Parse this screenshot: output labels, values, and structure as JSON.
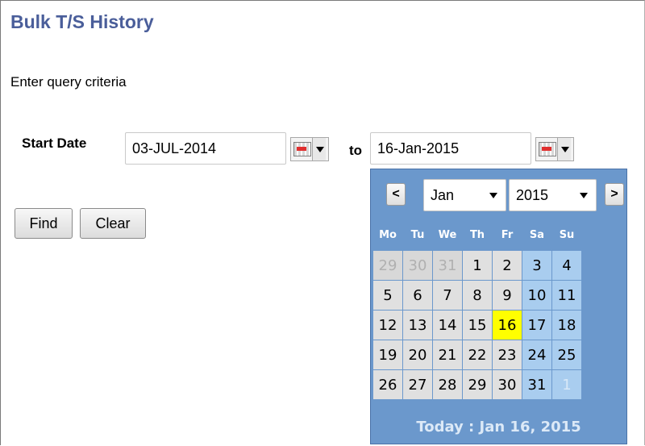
{
  "page": {
    "title": "Bulk T/S History",
    "subtitle": "Enter query criteria"
  },
  "form": {
    "start_label": "Start Date",
    "start_value": "03-JUL-2014",
    "to_label": "to",
    "end_value": "16-Jan-2015",
    "find_label": "Find",
    "clear_label": "Clear",
    "calendar_icon": "calendar-dropdown-icon"
  },
  "calendar": {
    "prev_label": "<",
    "next_label": ">",
    "month": "Jan",
    "year": "2015",
    "weekdays": [
      "Mo",
      "Tu",
      "We",
      "Th",
      "Fr",
      "Sa",
      "Su"
    ],
    "weeks": [
      [
        "29",
        "30",
        "31",
        "1",
        "2",
        "3",
        "4"
      ],
      [
        "5",
        "6",
        "7",
        "8",
        "9",
        "10",
        "11"
      ],
      [
        "12",
        "13",
        "14",
        "15",
        "16",
        "17",
        "18"
      ],
      [
        "19",
        "20",
        "21",
        "22",
        "23",
        "24",
        "25"
      ],
      [
        "26",
        "27",
        "28",
        "29",
        "30",
        "31",
        "1"
      ]
    ],
    "selected_day": "16",
    "today_label": "Today : Jan 16, 2015",
    "colors": {
      "background": "#6b98cc",
      "weekday_cell": "#e0e0e0",
      "weekend_cell": "#a9cdef",
      "selected": "#ffff00"
    }
  }
}
